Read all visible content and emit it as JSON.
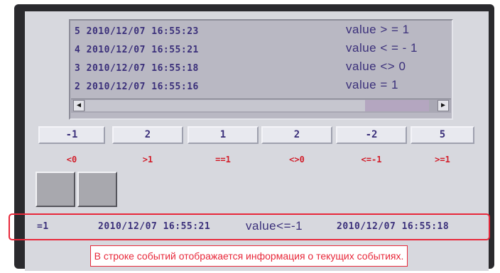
{
  "log": {
    "rows": [
      {
        "ts": "5 2010/12/07 16:55:23",
        "msg": "value > = 1"
      },
      {
        "ts": "4 2010/12/07 16:55:21",
        "msg": "value < = - 1"
      },
      {
        "ts": "3 2010/12/07 16:55:18",
        "msg": "value <> 0"
      },
      {
        "ts": "2 2010/12/07 16:55:16",
        "msg": "value = 1"
      }
    ],
    "scroll_left_glyph": "◀",
    "scroll_right_glyph": "▶"
  },
  "values": [
    "-1",
    "2",
    "1",
    "2",
    "-2",
    "5"
  ],
  "conditions": [
    "<0",
    ">1",
    "==1",
    "<>0",
    "<=-1",
    ">=1"
  ],
  "eventline": {
    "id": "=1",
    "ts1": "2010/12/07 16:55:21",
    "msg": "value<=-1",
    "ts2": "2010/12/07 16:55:18"
  },
  "caption": "В строке событий отображается информация о текущих событиях.",
  "colors": {
    "accent_red": "#e8283a",
    "text_blue": "#3a2f7a",
    "cond_red": "#d21e2a"
  }
}
